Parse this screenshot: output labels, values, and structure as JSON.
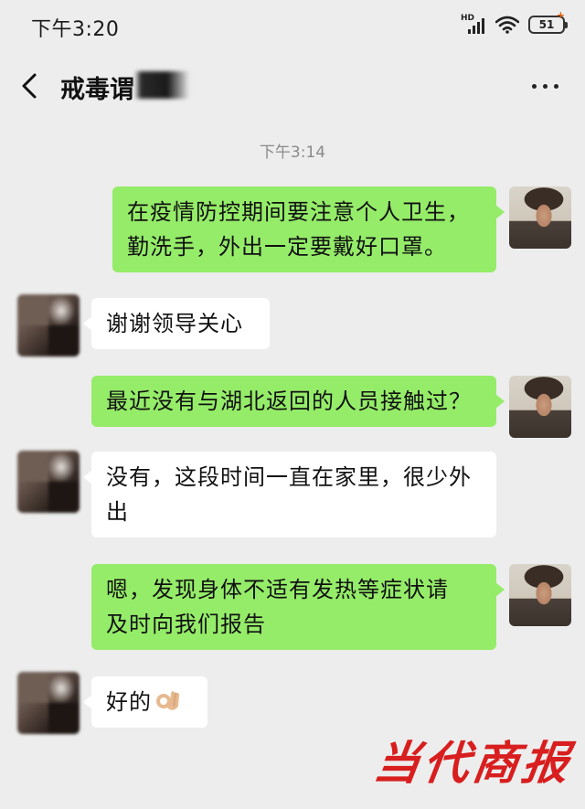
{
  "status_bar": {
    "time": "下午3:20",
    "network": "HD",
    "battery": "51"
  },
  "header": {
    "title": "戒毒谓"
  },
  "chat": {
    "timestamp": "下午3:14",
    "messages": [
      {
        "side": "right",
        "text_lines": [
          "在疫情防控期间要注意个人卫生，",
          "勤洗手，外出一定要戴好口罩。"
        ]
      },
      {
        "side": "left",
        "text_lines": [
          "谢谢领导关心"
        ]
      },
      {
        "side": "right",
        "text_lines": [
          "最近没有与湖北返回的人员接触过？"
        ]
      },
      {
        "side": "left",
        "text_lines": [
          "没有，这段时间一直在家里，很少外",
          "出"
        ]
      },
      {
        "side": "right",
        "text_lines": [
          "嗯，发现身体不适有发热等症状请",
          "及时向我们报告"
        ]
      },
      {
        "side": "left",
        "text_lines": [
          "好的"
        ],
        "emoji": "ok-hand-icon"
      }
    ]
  },
  "watermark": "当代商报",
  "colors": {
    "self_bubble": "#95ec69",
    "other_bubble": "#ffffff",
    "background": "#ededed",
    "watermark": "#d81e1e"
  }
}
